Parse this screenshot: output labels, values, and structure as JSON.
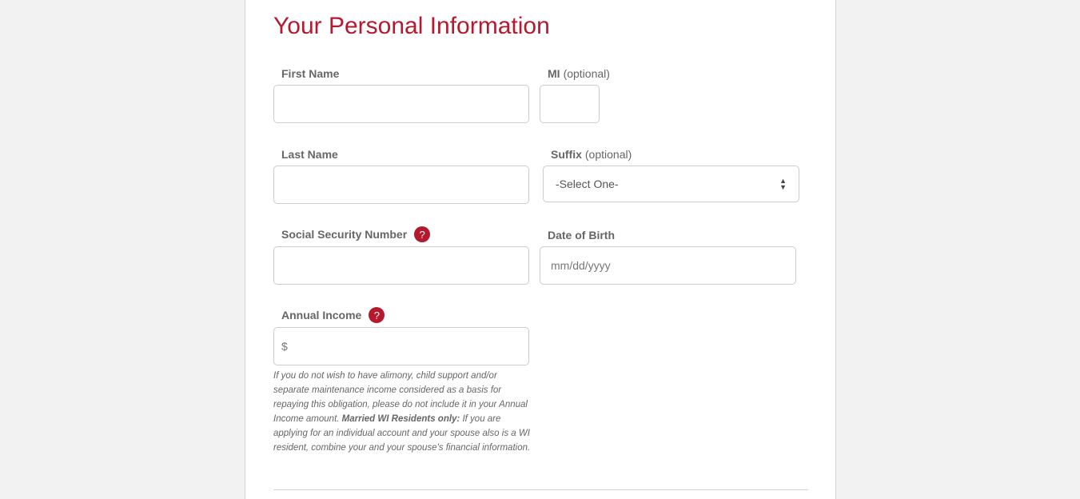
{
  "form": {
    "title": "Your Personal Information",
    "fields": {
      "first_name": {
        "label": "First Name",
        "value": "",
        "placeholder": ""
      },
      "mi": {
        "label": "MI",
        "optional": "(optional)",
        "value": "",
        "placeholder": ""
      },
      "last_name": {
        "label": "Last Name",
        "value": "",
        "placeholder": ""
      },
      "suffix": {
        "label": "Suffix",
        "optional": "(optional)",
        "selected": "-Select One-"
      },
      "ssn": {
        "label": "Social Security Number",
        "help": "?",
        "value": "",
        "placeholder": ""
      },
      "dob": {
        "label": "Date of Birth",
        "value": "",
        "placeholder": "mm/dd/yyyy"
      },
      "annual_income": {
        "label": "Annual Income",
        "help": "?",
        "prefix": "$",
        "value": "",
        "placeholder": ""
      }
    },
    "income_note": {
      "part1": "If you do not wish to have alimony, child support and/or separate maintenance income considered as a basis for repaying this obligation, please do not include it in your Annual Income amount. ",
      "bold": "Married WI Residents only:",
      "part2": " If you are applying for an individual account and your spouse also is a WI resident, combine your and your spouse's financial information."
    },
    "icons": {
      "help": "question-circle-icon",
      "select_arrows": "sort-arrows-icon"
    }
  },
  "colors": {
    "accent": "#b5192e",
    "label": "#666666",
    "background": "#f2f2f2"
  }
}
